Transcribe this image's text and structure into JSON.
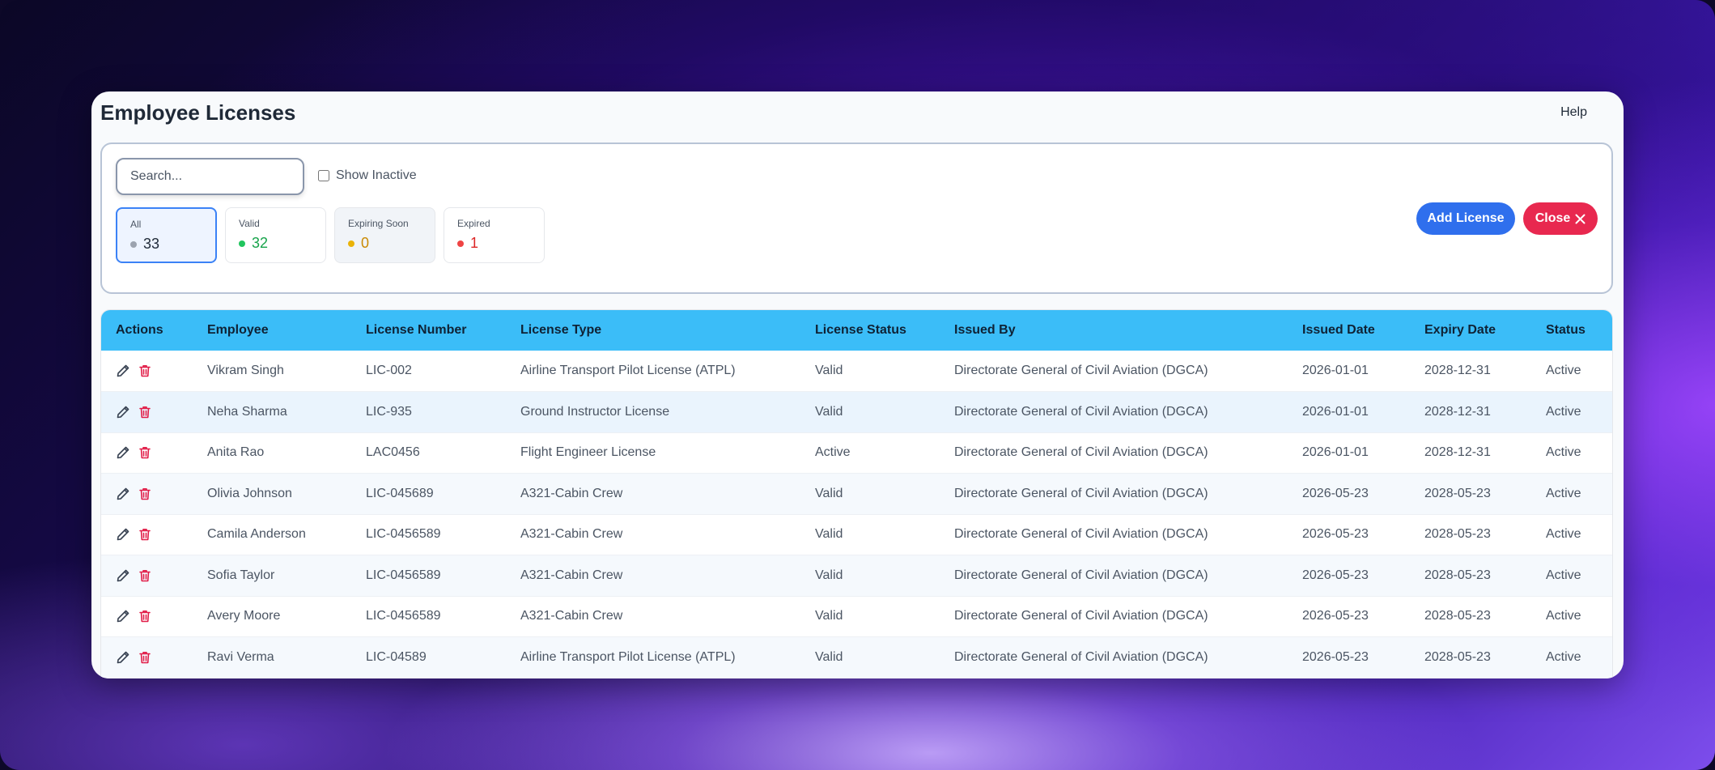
{
  "app": {
    "title": "Employee Licenses",
    "help_label": "Help"
  },
  "filters": {
    "search_placeholder": "Search...",
    "show_inactive_label": "Show Inactive",
    "cards": [
      {
        "label": "All",
        "count": "33",
        "dot_color": "#9ca3af",
        "value_color": "#1f2937"
      },
      {
        "label": "Valid",
        "count": "32",
        "dot_color": "#22c55e",
        "value_color": "#16a34a"
      },
      {
        "label": "Expiring Soon",
        "count": "0",
        "dot_color": "#eab308",
        "value_color": "#ca8a04"
      },
      {
        "label": "Expired",
        "count": "1",
        "dot_color": "#ef4444",
        "value_color": "#dc2626"
      }
    ]
  },
  "toolbar": {
    "add_label": "Add License",
    "close_label": "Close"
  },
  "icons": {
    "edit": "pencil-icon",
    "delete": "trash-icon",
    "close": "x-icon"
  },
  "table": {
    "headers": [
      "Actions",
      "Employee",
      "License Number",
      "License Type",
      "License Status",
      "Issued By",
      "Issued Date",
      "Expiry Date",
      "Status"
    ],
    "rows": [
      {
        "employee": "Vikram Singh",
        "license_number": "LIC-002",
        "license_type": "Airline Transport Pilot License (ATPL)",
        "license_status": "Valid",
        "issued_by": "Directorate General of Civil Aviation (DGCA)",
        "issued_date": "2026-01-01",
        "expiry_date": "2028-12-31",
        "status": "Active"
      },
      {
        "employee": "Neha Sharma",
        "license_number": "LIC-935",
        "license_type": "Ground Instructor License",
        "license_status": "Valid",
        "issued_by": "Directorate General of Civil Aviation (DGCA)",
        "issued_date": "2026-01-01",
        "expiry_date": "2028-12-31",
        "status": "Active"
      },
      {
        "employee": "Anita Rao",
        "license_number": "LAC0456",
        "license_type": "Flight Engineer License",
        "license_status": "Active",
        "issued_by": "Directorate General of Civil Aviation (DGCA)",
        "issued_date": "2026-01-01",
        "expiry_date": "2028-12-31",
        "status": "Active"
      },
      {
        "employee": "Olivia Johnson",
        "license_number": "LIC-045689",
        "license_type": "A321-Cabin Crew",
        "license_status": "Valid",
        "issued_by": "Directorate General of Civil Aviation (DGCA)",
        "issued_date": "2026-05-23",
        "expiry_date": "2028-05-23",
        "status": "Active"
      },
      {
        "employee": "Camila Anderson",
        "license_number": "LIC-0456589",
        "license_type": "A321-Cabin Crew",
        "license_status": "Valid",
        "issued_by": "Directorate General of Civil Aviation (DGCA)",
        "issued_date": "2026-05-23",
        "expiry_date": "2028-05-23",
        "status": "Active"
      },
      {
        "employee": "Sofia Taylor",
        "license_number": "LIC-0456589",
        "license_type": "A321-Cabin Crew",
        "license_status": "Valid",
        "issued_by": "Directorate General of Civil Aviation (DGCA)",
        "issued_date": "2026-05-23",
        "expiry_date": "2028-05-23",
        "status": "Active"
      },
      {
        "employee": "Avery Moore",
        "license_number": "LIC-0456589",
        "license_type": "A321-Cabin Crew",
        "license_status": "Valid",
        "issued_by": "Directorate General of Civil Aviation (DGCA)",
        "issued_date": "2026-05-23",
        "expiry_date": "2028-05-23",
        "status": "Active"
      },
      {
        "employee": "Ravi Verma",
        "license_number": "LIC-04589",
        "license_type": "Airline Transport Pilot License (ATPL)",
        "license_status": "Valid",
        "issued_by": "Directorate General of Civil Aviation (DGCA)",
        "issued_date": "2026-05-23",
        "expiry_date": "2028-05-23",
        "status": "Active"
      }
    ]
  }
}
